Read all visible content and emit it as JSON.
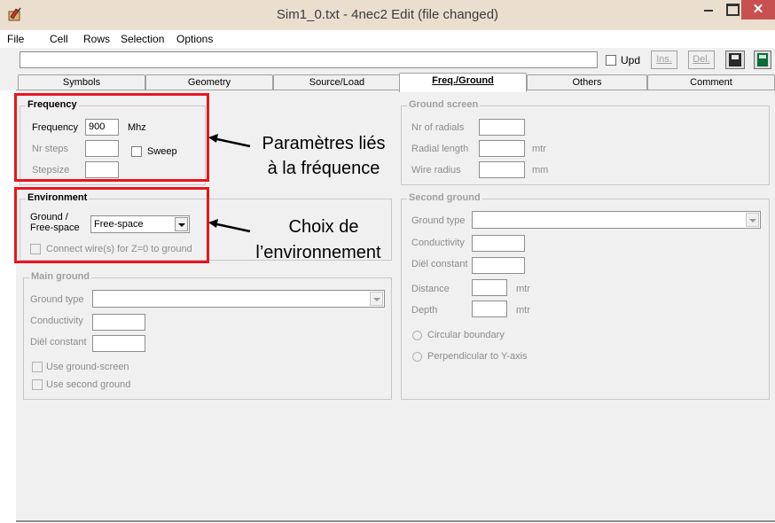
{
  "window": {
    "title": "Sim1_0.txt - 4nec2 Edit (file changed)",
    "close_glyph": "✕"
  },
  "menu": [
    "File",
    "Cell",
    "Rows",
    "Selection",
    "Options"
  ],
  "toolbar": {
    "upd_label": "Upd",
    "ins_label": "Ins.",
    "del_label": "Del."
  },
  "tabs": [
    "Symbols",
    "Geometry",
    "Source/Load",
    "Freq./Ground",
    "Others",
    "Comment"
  ],
  "active_tab": "Freq./Ground",
  "frequency": {
    "title": "Frequency",
    "frequency_label": "Frequency",
    "frequency_value": "900",
    "unit": "Mhz",
    "nr_steps_label": "Nr steps",
    "sweep_label": "Sweep",
    "stepsize_label": "Stepsize"
  },
  "environment": {
    "title": "Environment",
    "ground_label_1": "Ground  /",
    "ground_label_2": "Free-space",
    "ground_value": "Free-space",
    "connect_label": "Connect wire(s) for Z=0 to ground"
  },
  "main_ground": {
    "title": "Main ground",
    "ground_type_label": "Ground type",
    "conductivity_label": "Conductivity",
    "dielconst_label": "Diël constant",
    "use_screen_label": "Use ground-screen",
    "use_second_label": "Use second ground"
  },
  "ground_screen": {
    "title": "Ground screen",
    "nr_radials_label": "Nr of radials",
    "radial_length_label": "Radial length",
    "radial_length_unit": "mtr",
    "wire_radius_label": "Wire radius",
    "wire_radius_unit": "mm"
  },
  "second_ground": {
    "title": "Second ground",
    "ground_type_label": "Ground type",
    "conductivity_label": "Conductivity",
    "dielconst_label": "Diël constant",
    "distance_label": "Distance",
    "distance_unit": "mtr",
    "depth_label": "Depth",
    "depth_unit": "mtr",
    "circular_label": "Circular boundary",
    "perpendicular_label": "Perpendicular to Y-axis"
  },
  "annotations": {
    "freq_line1": "Paramètres liés",
    "freq_line2": "à la fréquence",
    "env_line1": "Choix de",
    "env_line2": "l’environnement"
  },
  "colors": {
    "annotation_box": "#e8151f",
    "titlebar": "#eadfcf",
    "close_button": "#c75050"
  }
}
